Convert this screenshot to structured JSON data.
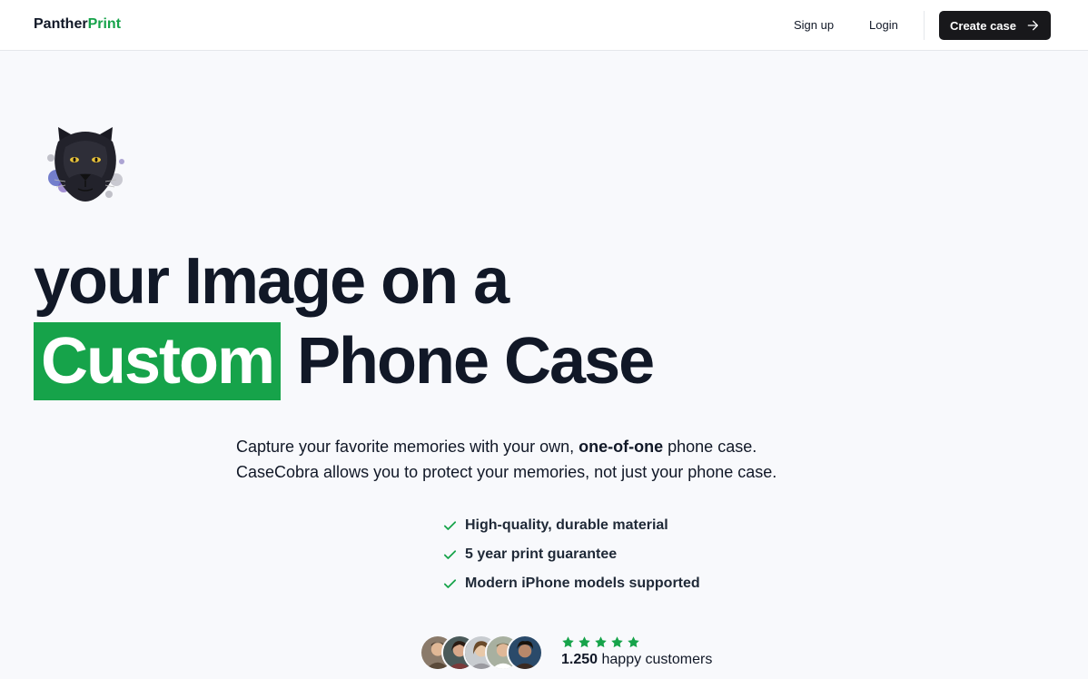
{
  "nav": {
    "logo_part1": "Panther",
    "logo_part2": "Print",
    "signup": "Sign up",
    "login": "Login",
    "cta": "Create case",
    "cta_icon": "arrow-right-icon"
  },
  "hero": {
    "headline_line1": "your Image on a",
    "headline_highlight": "Custom",
    "headline_line2_rest": "Phone Case",
    "desc_before": "Capture your favorite memories with your own, ",
    "desc_bold": "one-of-one",
    "desc_after": " phone case.",
    "desc_line2": "CaseCobra allows you to protect your memories, not just your phone case.",
    "features": [
      "High-quality, durable material",
      "5 year print guarantee",
      "Modern iPhone models supported"
    ],
    "rating_stars": 5,
    "customers_count": "1.250",
    "customers_label": " happy customers"
  },
  "colors": {
    "accent": "#16a34a",
    "dark": "#18181b",
    "background": "#f8f9fc"
  }
}
